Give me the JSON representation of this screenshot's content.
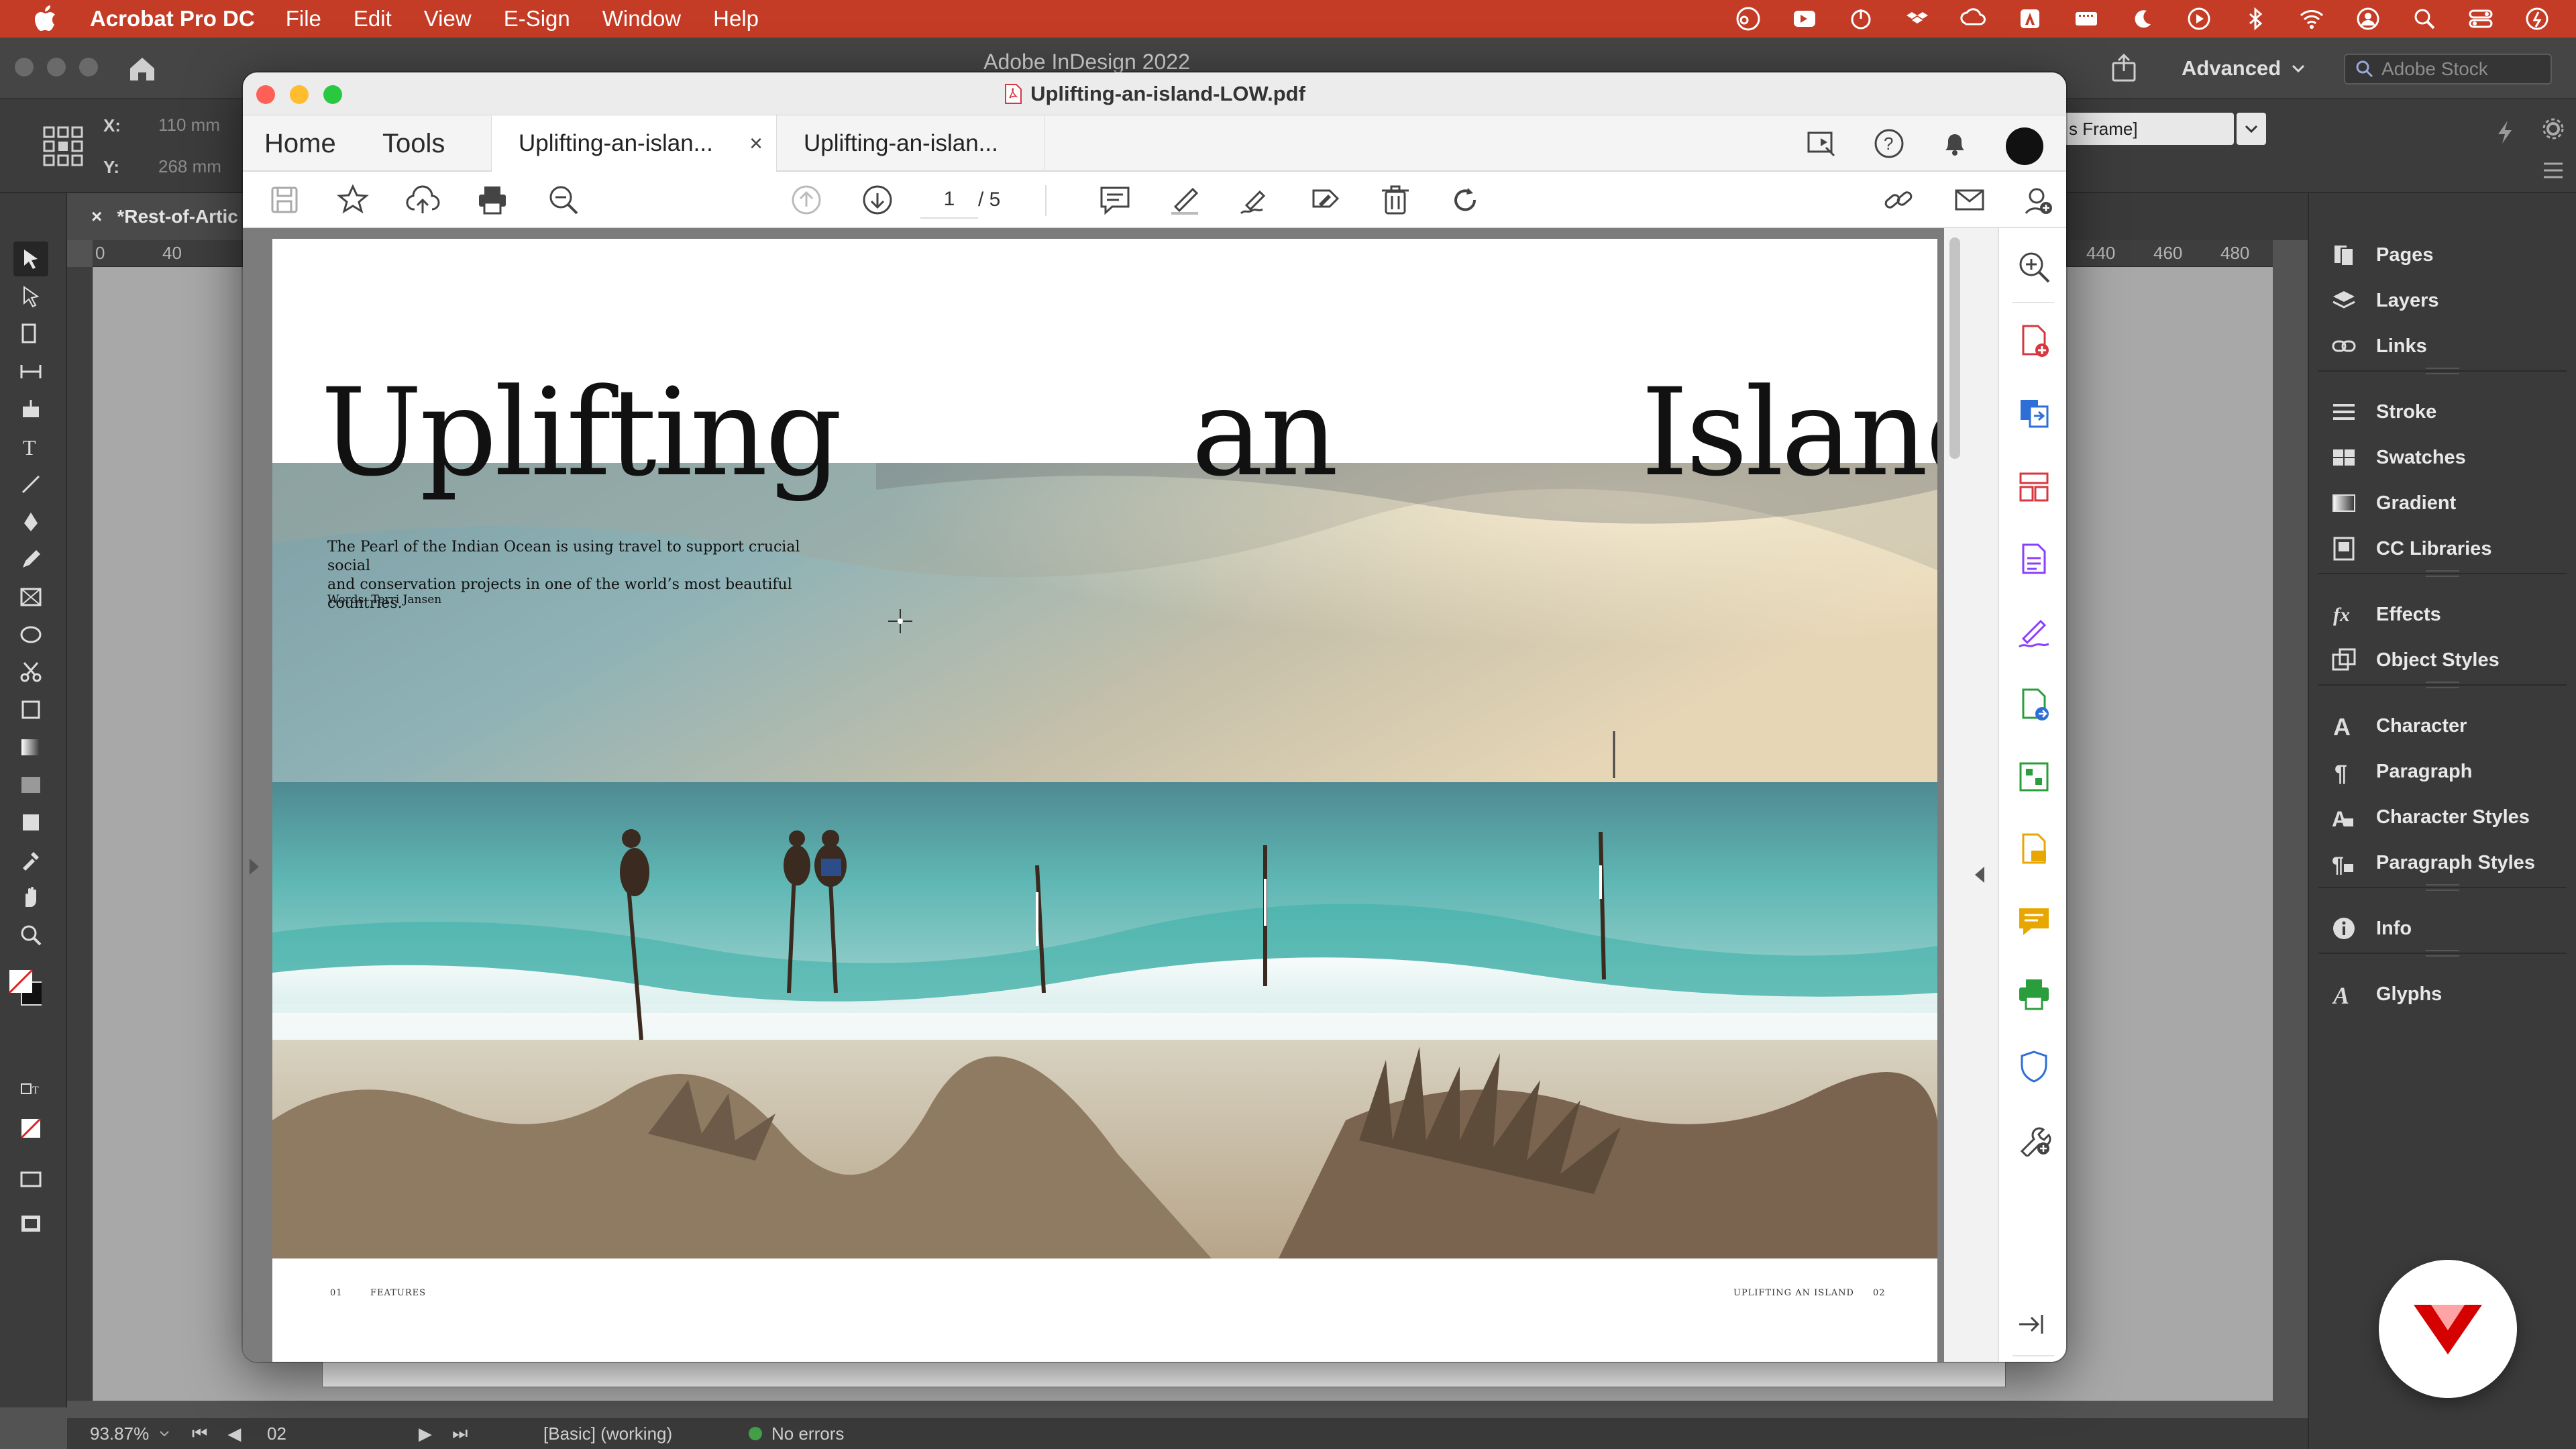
{
  "menubar": {
    "app_name": "Acrobat Pro DC",
    "items": [
      "File",
      "Edit",
      "View",
      "E-Sign",
      "Window",
      "Help"
    ]
  },
  "indesign": {
    "window_title": "Adobe InDesign 2022",
    "workspace": "Advanced",
    "stock_placeholder": "Adobe Stock",
    "x_label": "X:",
    "y_label": "Y:",
    "x_value": "110 mm",
    "y_value": "268 mm",
    "frame_select": "s Frame]",
    "doc_tab": "*Rest-of-Artic",
    "ruler_ticks": [
      "0",
      "40",
      "440",
      "460",
      "480"
    ],
    "status": {
      "zoom": "93.87%",
      "page": "02",
      "preflight_profile": "[Basic] (working)",
      "errors": "No errors"
    },
    "panels": [
      {
        "label": "Pages",
        "icon": "pages-icon"
      },
      {
        "label": "Layers",
        "icon": "layers-icon"
      },
      {
        "label": "Links",
        "icon": "links-icon"
      },
      {
        "label": "Stroke",
        "icon": "stroke-icon"
      },
      {
        "label": "Swatches",
        "icon": "swatches-icon"
      },
      {
        "label": "Gradient",
        "icon": "gradient-icon"
      },
      {
        "label": "CC Libraries",
        "icon": "cc-libraries-icon"
      },
      {
        "label": "Effects",
        "icon": "effects-icon"
      },
      {
        "label": "Object Styles",
        "icon": "object-styles-icon"
      },
      {
        "label": "Character",
        "icon": "character-icon"
      },
      {
        "label": "Paragraph",
        "icon": "paragraph-icon"
      },
      {
        "label": "Character Styles",
        "icon": "character-styles-icon"
      },
      {
        "label": "Paragraph Styles",
        "icon": "paragraph-styles-icon"
      },
      {
        "label": "Info",
        "icon": "info-icon"
      },
      {
        "label": "Glyphs",
        "icon": "glyphs-icon"
      }
    ]
  },
  "acrobat": {
    "window_title": "Uplifting-an-island-LOW.pdf",
    "nav_home": "Home",
    "nav_tools": "Tools",
    "tabs": [
      "Uplifting-an-islan...",
      "Uplifting-an-islan..."
    ],
    "current_page": "1",
    "total_pages": "/ 5"
  },
  "document": {
    "title_words": [
      "Uplifting",
      "an",
      "Island"
    ],
    "deck_line1": "The Pearl of the Indian Ocean is using travel to support crucial social",
    "deck_line2": "and conservation projects in one of the world’s most beautiful countries.",
    "byline": "Words: Terri Jansen",
    "folio_left_num": "01",
    "folio_left_section": "FEATURES",
    "folio_right_title": "UPLIFTING AN ISLAND",
    "folio_right_num": "02"
  },
  "colors": {
    "menubar": "#c43c26",
    "acrobat_red": "#d7373f",
    "acrobat_blue": "#2d6fd6",
    "acrobat_purple": "#8a3ffc",
    "acrobat_green": "#2a9d3c",
    "acrobat_yellow": "#e8a600"
  }
}
